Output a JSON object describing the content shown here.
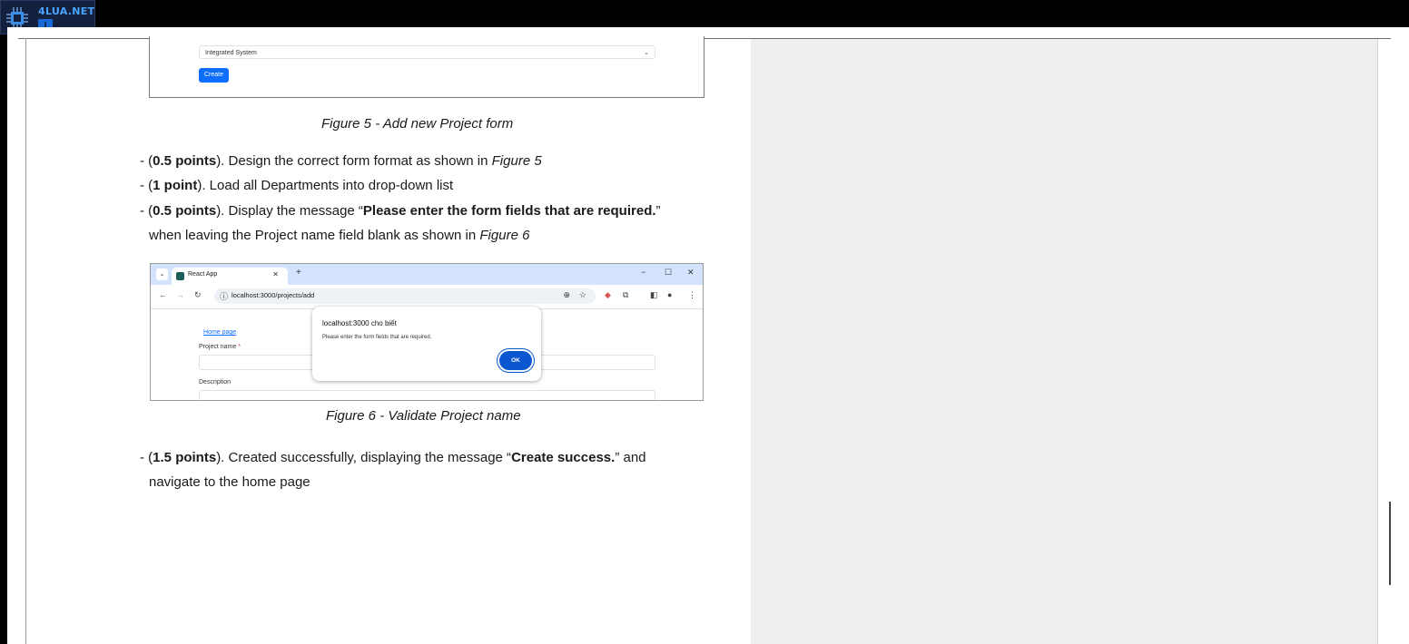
{
  "logo": {
    "text": "4LUA.NET"
  },
  "figure5": {
    "select_value": "Integrated System",
    "create_button": "Create",
    "caption": "Figure 5 - Add new Project form"
  },
  "requirements": [
    {
      "prefix": "- (",
      "points": "0.5 points",
      "text": "). Design the correct form format as shown in ",
      "ref": "Figure 5"
    },
    {
      "prefix": "- (",
      "points": "1 point",
      "text": "). Load all Departments into drop-down list"
    },
    {
      "prefix": "- (",
      "points": "0.5 points",
      "text": "). Display the message “",
      "message": "Please enter the form fields that are required.",
      "after": "”"
    },
    {
      "text": "when leaving the Project name field blank as shown in ",
      "ref": "Figure 6"
    }
  ],
  "figure6": {
    "tab_title": "React App",
    "url": "localhost:3000/projects/add",
    "home_link": "Home page",
    "project_name_label": "Project name",
    "required_mark": "*",
    "description_label": "Description",
    "dialog_title": "localhost:3000 cho biết",
    "dialog_message": "Please enter the form fields that are required.",
    "ok_button": "OK",
    "caption": "Figure 6 - Validate Project name"
  },
  "final": {
    "prefix": "- (",
    "points": "1.5 points",
    "text": "). Created successfully, displaying the message “",
    "message": "Create success.",
    "after": "” and",
    "line2": "navigate to the home page"
  }
}
